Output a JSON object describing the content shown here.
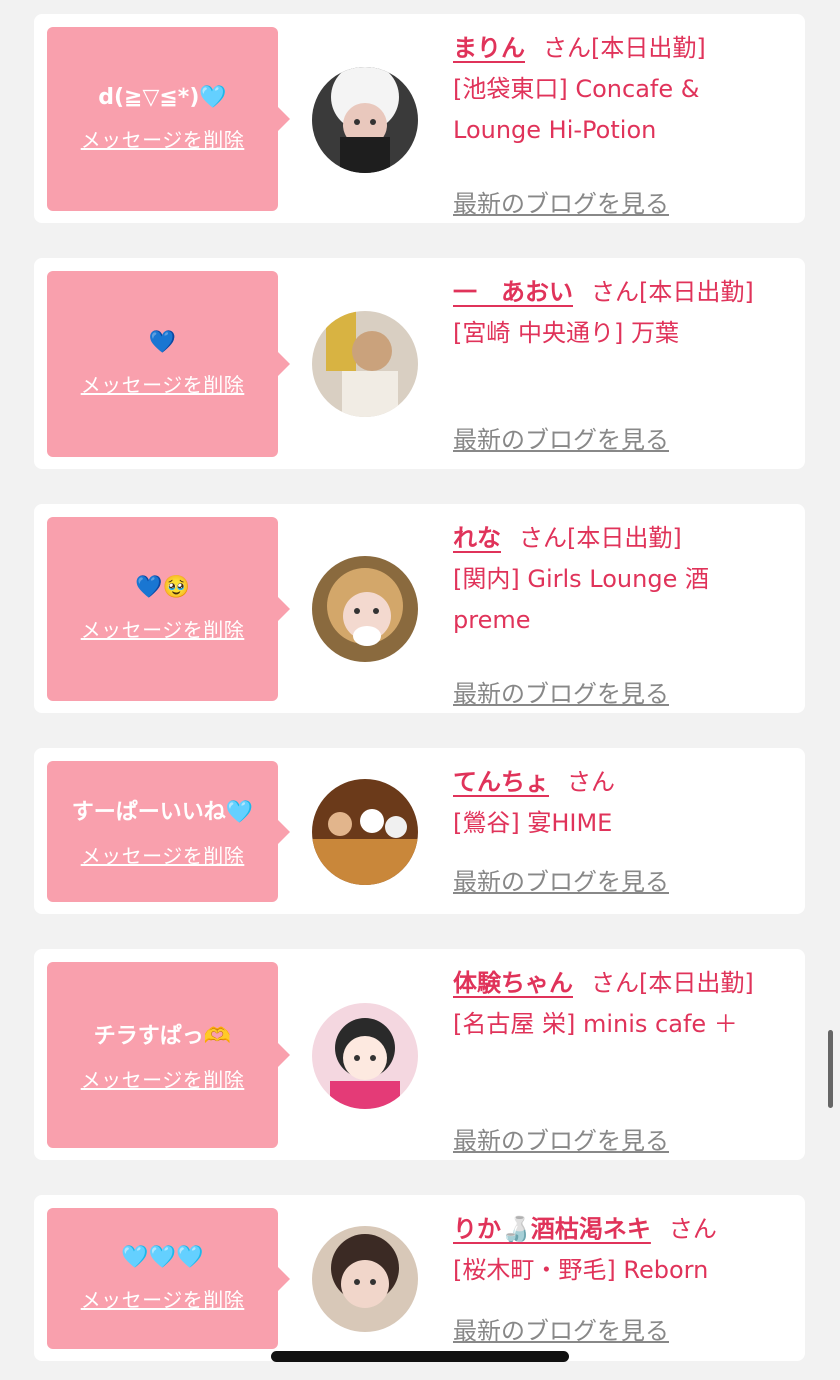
{
  "colors": {
    "accent": "#e0335a",
    "bubble": "#f9a0ad",
    "muted": "#888888",
    "background": "#f2f2f2"
  },
  "rows": [
    {
      "message": "d(≧▽≦*)🩵",
      "delete_label": "メッセージを削除",
      "name": "まりん",
      "san": "さん",
      "status": "[本日出勤]",
      "shop_line1": "[池袋東口] Concafe &",
      "shop_line2": "Lounge Hi-Potion",
      "blog_label": "最新のブログを見る"
    },
    {
      "message": "💙",
      "delete_label": "メッセージを削除",
      "name": "一　あおい",
      "san": "さん",
      "status": "[本日出勤]",
      "shop_line1": "[宮崎 中央通り] 万葉",
      "shop_line2": "",
      "blog_label": "最新のブログを見る"
    },
    {
      "message": "💙🥹",
      "delete_label": "メッセージを削除",
      "name": "れな",
      "san": "さん",
      "status": "[本日出勤]",
      "shop_line1": "[関内] Girls Lounge 酒",
      "shop_line2": "preme",
      "blog_label": "最新のブログを見る"
    },
    {
      "message": "すーぱーいいね🩵",
      "delete_label": "メッセージを削除",
      "name": "てんちょ",
      "san": "さん",
      "status": "",
      "shop_line1": "[鶯谷] 宴HIME",
      "shop_line2": "",
      "blog_label": "最新のブログを見る"
    },
    {
      "message": "チラすぱっ🫶",
      "delete_label": "メッセージを削除",
      "name": "体験ちゃん",
      "san": "さん",
      "status": "[本日出勤]",
      "shop_line1": "[名古屋 栄] minis cafe ＋",
      "shop_line2": "",
      "blog_label": "最新のブログを見る"
    },
    {
      "message": "🩵🩵🩵",
      "delete_label": "メッセージを削除",
      "name": "りか🍶酒枯渇ネキ",
      "san": "さん",
      "status": "",
      "shop_line1": "[桜木町・野毛] Reborn",
      "shop_line2": "",
      "blog_label": "最新のブログを見る"
    }
  ]
}
